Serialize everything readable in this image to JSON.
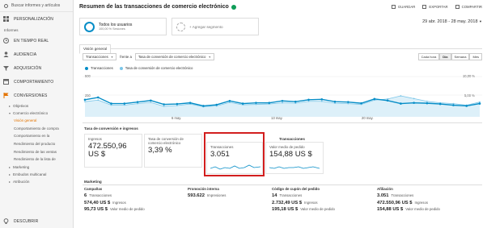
{
  "sidebar": {
    "search": "Buscar informes y artículos",
    "personalization": "PERSONALIZACIÓN",
    "section_informes": "Informes",
    "items": [
      {
        "label": "EN TIEMPO REAL",
        "icon": "clock-icon"
      },
      {
        "label": "AUDIENCIA",
        "icon": "person-icon"
      },
      {
        "label": "ADQUISICIÓN",
        "icon": "acquisition-icon"
      },
      {
        "label": "COMPORTAMIENTO",
        "icon": "behavior-icon"
      },
      {
        "label": "CONVERSIONES",
        "icon": "flag-icon"
      }
    ],
    "conv_sub": [
      {
        "label": "Objetivos",
        "caret": "▸"
      },
      {
        "label": "Comercio electrónico",
        "caret": "▾"
      }
    ],
    "ecom_items": [
      "Visión general",
      "Comportamiento de compra",
      "Comportamiento en la",
      "Rendimiento del producto",
      "Rendimiento de las ventas",
      "Rendimiento de la lista de"
    ],
    "more_sub": [
      {
        "label": "Marketing",
        "caret": "▸"
      },
      {
        "label": "Embudos multicanal",
        "caret": "▸"
      },
      {
        "label": "Atribución",
        "caret": "▸"
      }
    ],
    "discover": "DESCUBRIR",
    "colors": {
      "accent": "#e37400",
      "beta": "#2e7d32"
    }
  },
  "header": {
    "title": "Resumen de las transacciones de comercio electrónico",
    "actions": [
      "GUARDAR",
      "EXPORTAR",
      "COMPARTIR"
    ]
  },
  "segments": {
    "current_title": "Todos los usuarios",
    "current_sub": "100,00 % Sesiones",
    "add_label": "+ Agregar segmento"
  },
  "date_range": "29 abr. 2018 - 28 may. 2018",
  "tab": "Visión general",
  "controls": {
    "metric1": "Transacciones",
    "vs": "frente a",
    "metric2": "Tasa de conversión de comercio electrónico",
    "periods": [
      "Cada hora",
      "Día",
      "Semana",
      "Mes"
    ],
    "active_period": "Día"
  },
  "chart_data": {
    "type": "line",
    "series": [
      {
        "name": "Transacciones",
        "color": "#058dc7",
        "values": [
          200,
          230,
          150,
          150,
          170,
          190,
          140,
          145,
          160,
          120,
          135,
          185,
          150,
          160,
          160,
          185,
          175,
          200,
          205,
          175,
          170,
          155,
          210,
          190,
          150,
          160,
          155,
          145,
          130,
          120,
          150
        ]
      },
      {
        "name": "Tasa de conversión de comercio electrónico",
        "color": "#7ac5e8",
        "values": [
          3.5,
          3.9,
          2.6,
          2.6,
          3.0,
          3.3,
          2.3,
          2.5,
          2.9,
          2.2,
          2.4,
          3.3,
          2.7,
          2.8,
          2.9,
          3.2,
          3.1,
          3.6,
          3.6,
          3.1,
          3.0,
          2.8,
          3.9,
          4.2,
          5.0,
          4.3,
          3.6,
          3.2,
          3.0,
          2.6,
          3.4
        ]
      }
    ],
    "ytick_left": [
      "500",
      "250"
    ],
    "ytick_right": [
      "10,00 %",
      "5,00 %"
    ],
    "xlabels": [
      "6 may.",
      "13 may.",
      "20 may."
    ]
  },
  "conv_rate_heading": "Tasa de conversión e ingresos",
  "transactions_heading": "Transacciones",
  "cards": [
    {
      "label": "Ingresos",
      "value": "472.550,96 US $"
    },
    {
      "label": "Tasa de conversión de comercio electrónico",
      "value": "3,39 %"
    },
    {
      "label": "Transacciones",
      "value": "3.051"
    },
    {
      "label": "Valor medio de pedido",
      "value": "154,88 US $"
    }
  ],
  "marketing": {
    "heading": "Marketing",
    "columns": [
      {
        "title": "Campañas",
        "rows": [
          {
            "value": "6",
            "unit": "Transacciones"
          },
          {
            "value": "574,40 US $",
            "unit": "Ingresos"
          },
          {
            "value": "95,73 US $",
            "unit": "Valor medio de pedido"
          }
        ]
      },
      {
        "title": "Promoción interna",
        "rows": [
          {
            "value": "593.622",
            "unit": "Impresiones"
          }
        ]
      },
      {
        "title": "Código de cupón del pedido",
        "rows": [
          {
            "value": "14",
            "unit": "Transacciones"
          },
          {
            "value": "2.732,49 US $",
            "unit": "Ingresos"
          },
          {
            "value": "195,18 US $",
            "unit": "Valor medio de pedido"
          }
        ]
      },
      {
        "title": "Afiliación",
        "rows": [
          {
            "value": "3.051",
            "unit": "Transacciones"
          },
          {
            "value": "472.550,96 US $",
            "unit": "Ingresos"
          },
          {
            "value": "154,88 US $",
            "unit": "Valor medio de pedido"
          }
        ]
      }
    ]
  }
}
